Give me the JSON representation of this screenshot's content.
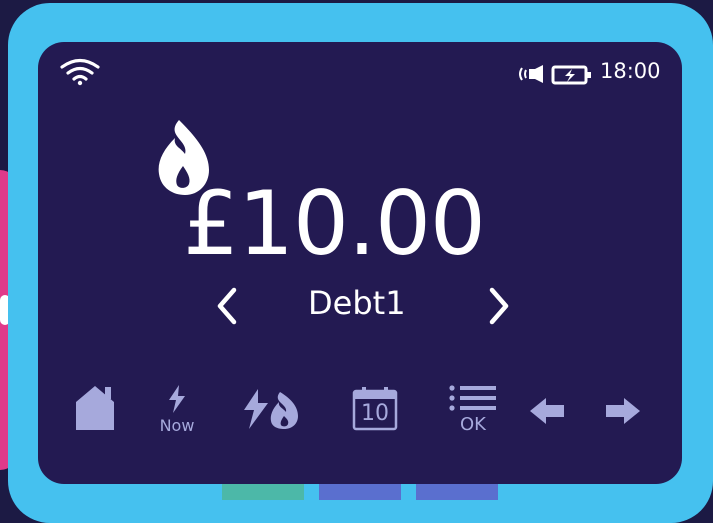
{
  "status_bar": {
    "time": "18:00",
    "icons": [
      "wifi-icon",
      "speaker-icon",
      "battery-charging-icon"
    ]
  },
  "display": {
    "fuel_icon": "gas-flame-icon",
    "amount": "£10.00",
    "tariff_label": "Debt1",
    "prev_icon": "chevron-left-icon",
    "next_icon": "chevron-right-icon"
  },
  "menu": {
    "items": [
      {
        "icon": "home-icon",
        "label": ""
      },
      {
        "icon": "lightning-icon",
        "label": "Now"
      },
      {
        "icon": "electricity-and-gas-icon",
        "label": ""
      },
      {
        "icon": "calendar-icon",
        "label": "10"
      },
      {
        "icon": "list-icon",
        "label": "OK"
      },
      {
        "icon": "arrow-left-icon",
        "label": ""
      },
      {
        "icon": "arrow-right-icon",
        "label": ""
      }
    ]
  },
  "colors": {
    "frame": "#45c1ef",
    "screen": "#231a52",
    "background": "#1c1a44",
    "menu_icons": "#a6a9dc",
    "text": "#ffffff",
    "button_green": "#4cb8a8",
    "button_blue": "#5a6fcf",
    "side_tab": "#e03a8a"
  }
}
